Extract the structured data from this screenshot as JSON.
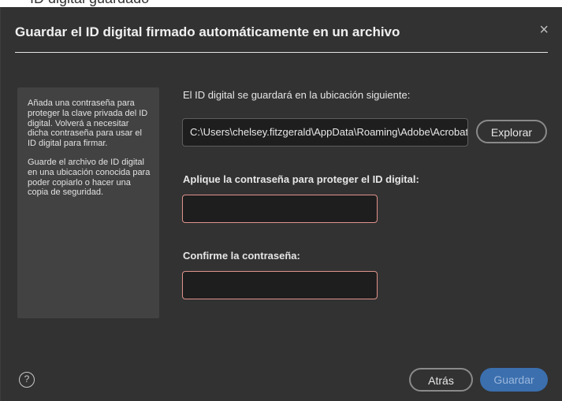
{
  "background_snippet": "ID digital guardado",
  "dialog": {
    "title": "Guardar el ID digital firmado automáticamente en un archivo",
    "close_symbol": "×"
  },
  "info": {
    "paragraph1": "Añada una contraseña para proteger la clave privada del ID digital. Volverá a necesitar dicha contraseña para usar el ID digital para firmar.",
    "paragraph2": "Guarde el archivo de ID digital en una ubicación conocida para poder copiarlo o hacer una copia de seguridad."
  },
  "location": {
    "label": "El ID digital se guardará en la ubicación siguiente:",
    "path": "C:\\Users\\chelsey.fitzgerald\\AppData\\Roaming\\Adobe\\Acrobat",
    "browse_label": "Explorar"
  },
  "password": {
    "label": "Aplique la contraseña para proteger el ID digital:",
    "value": ""
  },
  "confirm": {
    "label": "Confirme la contraseña:",
    "value": ""
  },
  "footer": {
    "help_symbol": "?",
    "back_label": "Atrás",
    "save_label": "Guardar"
  },
  "colors": {
    "dialog_bg": "#323232",
    "panel_bg": "#424242",
    "field_bg": "#1e1e1e",
    "error_border": "#e0938c",
    "primary_button": "#3b6fae"
  },
  "icons": {
    "close": "close-icon",
    "help": "help-icon"
  }
}
